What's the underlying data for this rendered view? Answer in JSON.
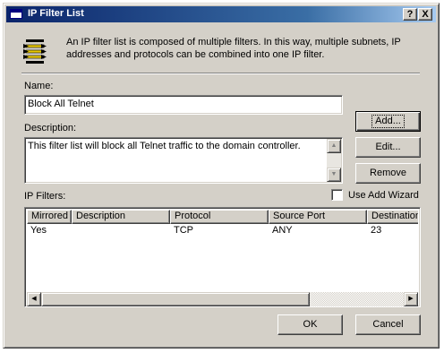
{
  "window": {
    "title": "IP Filter List"
  },
  "titlebar_buttons": {
    "help": "?",
    "close": "X"
  },
  "info": {
    "icon": "filter-list-icon",
    "text": "An IP filter list is composed of multiple filters. In this way, multiple subnets, IP addresses and protocols can be combined into one IP filter."
  },
  "name": {
    "label": "Name:",
    "value": "Block All Telnet"
  },
  "description": {
    "label": "Description:",
    "value": "This filter list will block all Telnet traffic to the domain controller."
  },
  "buttons": {
    "add": "Add...",
    "edit": "Edit...",
    "remove": "Remove",
    "ok": "OK",
    "cancel": "Cancel"
  },
  "ip_filters": {
    "label": "IP Filters:",
    "wizard_label": "Use Add Wizard",
    "wizard_checked": false,
    "columns": [
      "Mirrored",
      "Description",
      "Protocol",
      "Source Port",
      "Destination"
    ],
    "rows": [
      [
        "Yes",
        "",
        "TCP",
        "ANY",
        "23"
      ]
    ]
  },
  "colors": {
    "titlebar": "#0a246a",
    "face": "#d4d0c8"
  }
}
